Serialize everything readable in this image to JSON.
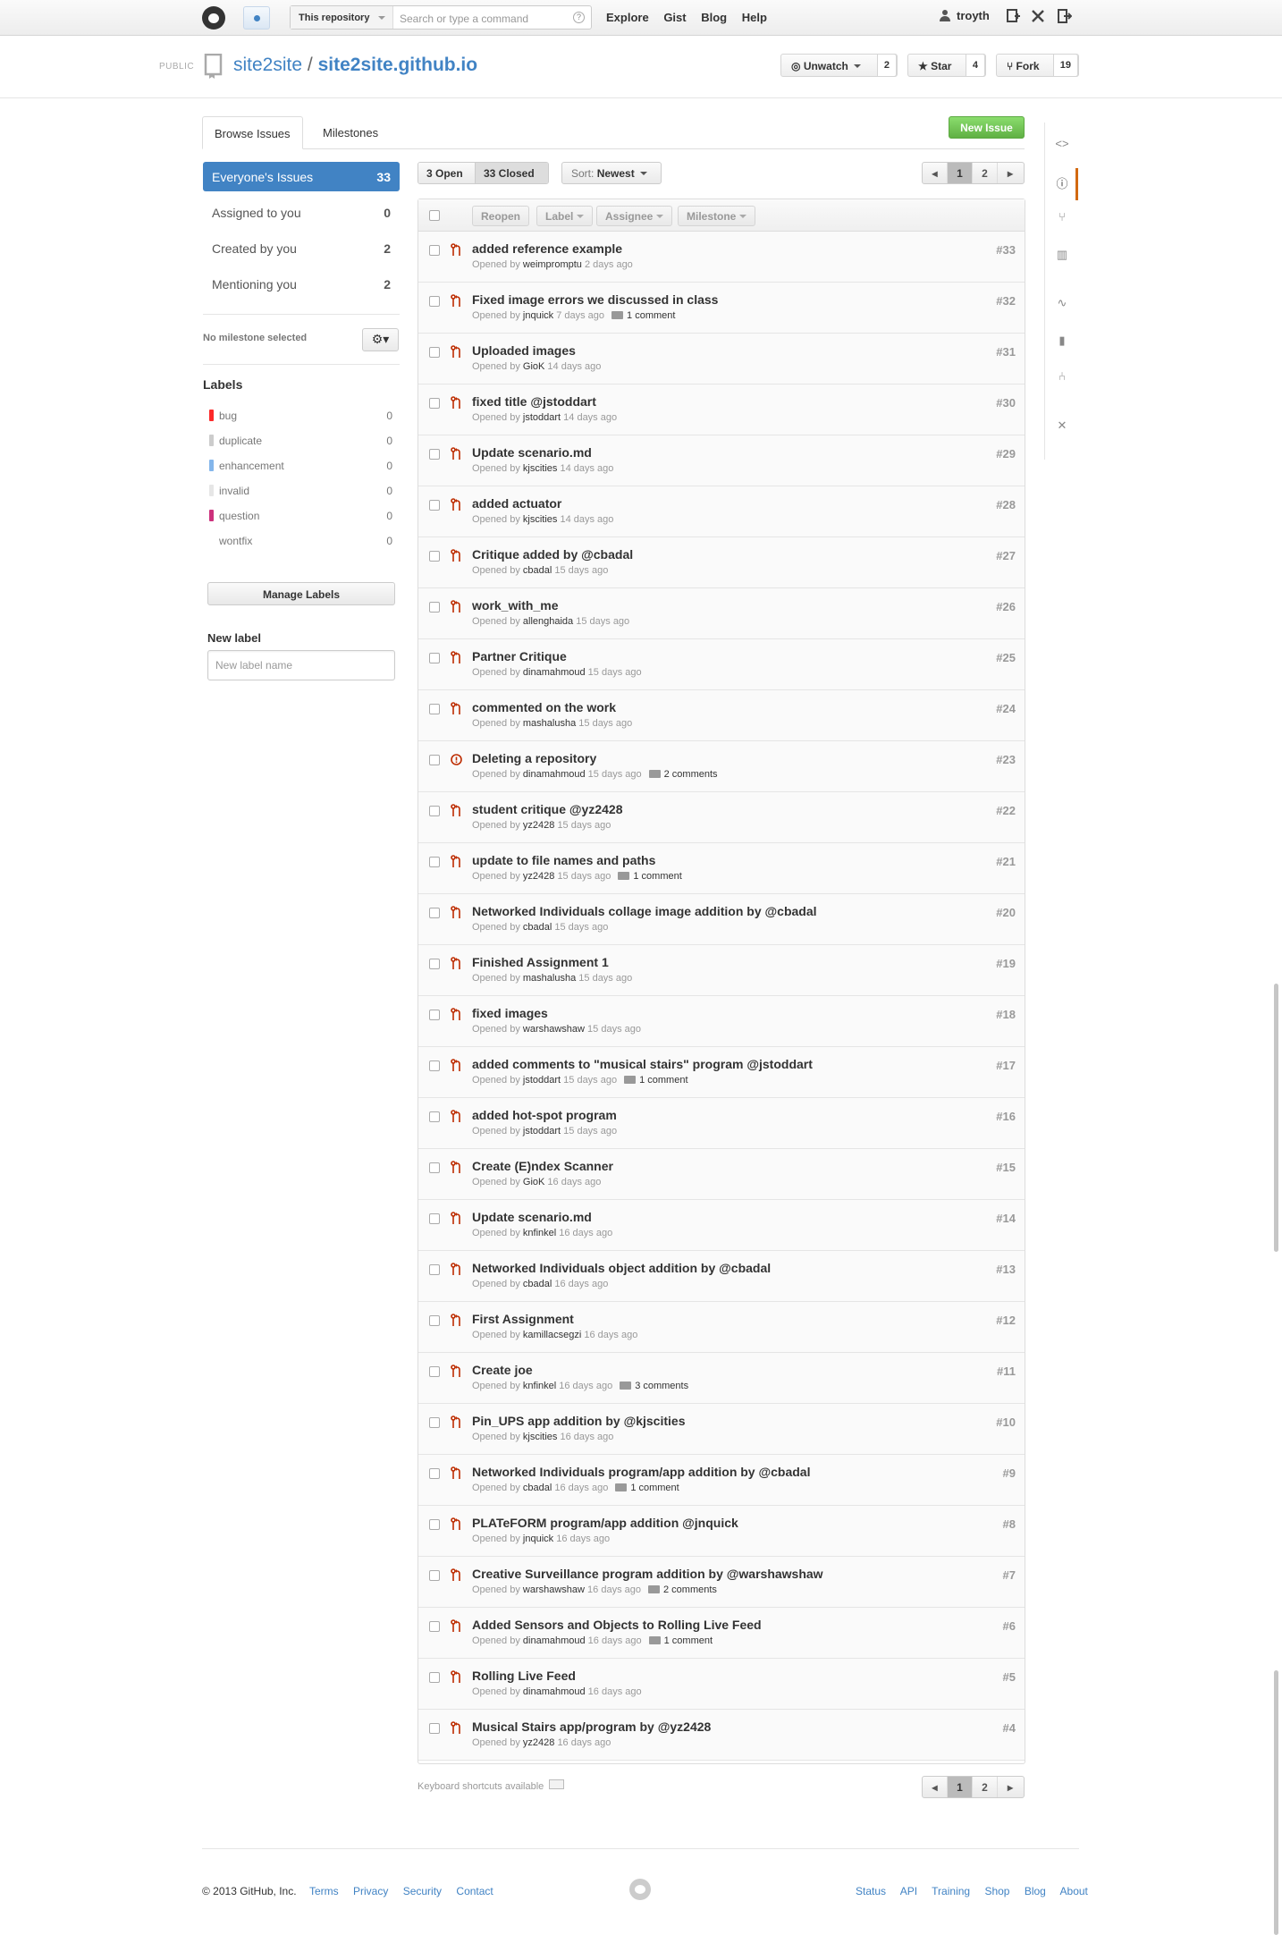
{
  "header": {
    "search_scope": "This repository",
    "search_placeholder": "Search or type a command",
    "search_help": "?",
    "nav": [
      "Explore",
      "Gist",
      "Blog",
      "Help"
    ],
    "username": "troyth"
  },
  "repo": {
    "visibility": "PUBLIC",
    "owner": "site2site",
    "separator": "/",
    "name": "site2site.github.io",
    "unwatch_label": "Unwatch",
    "watch_count": "2",
    "star_label": "Star",
    "star_count": "4",
    "fork_label": "Fork",
    "fork_count": "19"
  },
  "tabs": {
    "browse": "Browse Issues",
    "milestones": "Milestones",
    "new_issue": "New Issue"
  },
  "filters": [
    {
      "label": "Everyone's Issues",
      "count": "33"
    },
    {
      "label": "Assigned to you",
      "count": "0"
    },
    {
      "label": "Created by you",
      "count": "2"
    },
    {
      "label": "Mentioning you",
      "count": "2"
    }
  ],
  "milestone_text": "No milestone selected",
  "labels_heading": "Labels",
  "labels": [
    {
      "name": "bug",
      "count": "0",
      "color": "#fc2929"
    },
    {
      "name": "duplicate",
      "count": "0",
      "color": "#cccccc"
    },
    {
      "name": "enhancement",
      "count": "0",
      "color": "#84b6eb"
    },
    {
      "name": "invalid",
      "count": "0",
      "color": "#e6e6e6"
    },
    {
      "name": "question",
      "count": "0",
      "color": "#cc317c"
    },
    {
      "name": "wontfix",
      "count": "0",
      "color": "#ffffff"
    }
  ],
  "manage_labels": "Manage Labels",
  "new_label_heading": "New label",
  "new_label_placeholder": "New label name",
  "state": {
    "open": "3 Open",
    "closed": "33 Closed"
  },
  "sort": {
    "prefix": "Sort:",
    "value": "Newest"
  },
  "pagination": [
    "1",
    "2"
  ],
  "list_actions": [
    "Reopen",
    "Label",
    "Assignee",
    "Milestone"
  ],
  "issues": [
    {
      "title": "added reference example",
      "author": "weimpromptu",
      "age": "2 days ago",
      "comments": "",
      "number": "#33",
      "kind": "pr"
    },
    {
      "title": "Fixed image errors we discussed in class",
      "author": "jnquick",
      "age": "7 days ago",
      "comments": "1 comment",
      "number": "#32",
      "kind": "pr"
    },
    {
      "title": "Uploaded images",
      "author": "GioK",
      "age": "14 days ago",
      "comments": "",
      "number": "#31",
      "kind": "pr"
    },
    {
      "title": "fixed title @jstoddart",
      "author": "jstoddart",
      "age": "14 days ago",
      "comments": "",
      "number": "#30",
      "kind": "pr"
    },
    {
      "title": "Update scenario.md",
      "author": "kjscities",
      "age": "14 days ago",
      "comments": "",
      "number": "#29",
      "kind": "pr"
    },
    {
      "title": "added actuator",
      "author": "kjscities",
      "age": "14 days ago",
      "comments": "",
      "number": "#28",
      "kind": "pr"
    },
    {
      "title": "Critique added by @cbadal",
      "author": "cbadal",
      "age": "15 days ago",
      "comments": "",
      "number": "#27",
      "kind": "pr"
    },
    {
      "title": "work_with_me",
      "author": "allenghaida",
      "age": "15 days ago",
      "comments": "",
      "number": "#26",
      "kind": "pr"
    },
    {
      "title": "Partner Critique",
      "author": "dinamahmoud",
      "age": "15 days ago",
      "comments": "",
      "number": "#25",
      "kind": "pr"
    },
    {
      "title": "commented on the work",
      "author": "mashalusha",
      "age": "15 days ago",
      "comments": "",
      "number": "#24",
      "kind": "pr"
    },
    {
      "title": "Deleting a repository",
      "author": "dinamahmoud",
      "age": "15 days ago",
      "comments": "2 comments",
      "number": "#23",
      "kind": "issue"
    },
    {
      "title": "student critique @yz2428",
      "author": "yz2428",
      "age": "15 days ago",
      "comments": "",
      "number": "#22",
      "kind": "pr"
    },
    {
      "title": "update to file names and paths",
      "author": "yz2428",
      "age": "15 days ago",
      "comments": "1 comment",
      "number": "#21",
      "kind": "pr"
    },
    {
      "title": "Networked Individuals collage image addition by @cbadal",
      "author": "cbadal",
      "age": "15 days ago",
      "comments": "",
      "number": "#20",
      "kind": "pr"
    },
    {
      "title": "Finished Assignment 1",
      "author": "mashalusha",
      "age": "15 days ago",
      "comments": "",
      "number": "#19",
      "kind": "pr"
    },
    {
      "title": "fixed images",
      "author": "warshawshaw",
      "age": "15 days ago",
      "comments": "",
      "number": "#18",
      "kind": "pr"
    },
    {
      "title": "added comments to \"musical stairs\" program @jstoddart",
      "author": "jstoddart",
      "age": "15 days ago",
      "comments": "1 comment",
      "number": "#17",
      "kind": "pr"
    },
    {
      "title": "added hot-spot program",
      "author": "jstoddart",
      "age": "15 days ago",
      "comments": "",
      "number": "#16",
      "kind": "pr"
    },
    {
      "title": "Create (E)ndex Scanner",
      "author": "GioK",
      "age": "16 days ago",
      "comments": "",
      "number": "#15",
      "kind": "pr"
    },
    {
      "title": "Update scenario.md",
      "author": "knfinkel",
      "age": "16 days ago",
      "comments": "",
      "number": "#14",
      "kind": "pr"
    },
    {
      "title": "Networked Individuals object addition by @cbadal",
      "author": "cbadal",
      "age": "16 days ago",
      "comments": "",
      "number": "#13",
      "kind": "pr"
    },
    {
      "title": "First Assignment",
      "author": "kamillacsegzi",
      "age": "16 days ago",
      "comments": "",
      "number": "#12",
      "kind": "pr"
    },
    {
      "title": "Create joe",
      "author": "knfinkel",
      "age": "16 days ago",
      "comments": "3 comments",
      "number": "#11",
      "kind": "pr"
    },
    {
      "title": "Pin_UPS app addition by @kjscities",
      "author": "kjscities",
      "age": "16 days ago",
      "comments": "",
      "number": "#10",
      "kind": "pr"
    },
    {
      "title": "Networked Individuals program/app addition by @cbadal",
      "author": "cbadal",
      "age": "16 days ago",
      "comments": "1 comment",
      "number": "#9",
      "kind": "pr"
    },
    {
      "title": "PLATeFORM program/app addition @jnquick",
      "author": "jnquick",
      "age": "16 days ago",
      "comments": "",
      "number": "#8",
      "kind": "pr"
    },
    {
      "title": "Creative Surveillance program addition by @warshawshaw",
      "author": "warshawshaw",
      "age": "16 days ago",
      "comments": "2 comments",
      "number": "#7",
      "kind": "pr"
    },
    {
      "title": "Added Sensors and Objects to Rolling Live Feed",
      "author": "dinamahmoud",
      "age": "16 days ago",
      "comments": "1 comment",
      "number": "#6",
      "kind": "pr"
    },
    {
      "title": "Rolling Live Feed",
      "author": "dinamahmoud",
      "age": "16 days ago",
      "comments": "",
      "number": "#5",
      "kind": "pr"
    },
    {
      "title": "Musical Stairs app/program by @yz2428",
      "author": "yz2428",
      "age": "16 days ago",
      "comments": "",
      "number": "#4",
      "kind": "pr"
    }
  ],
  "opened_by": "Opened by",
  "keyboard_shortcuts": "Keyboard shortcuts available",
  "footer": {
    "copyright": "© 2013 GitHub, Inc.",
    "left_links": [
      "Terms",
      "Privacy",
      "Security",
      "Contact"
    ],
    "right_links": [
      "Status",
      "API",
      "Training",
      "Shop",
      "Blog",
      "About"
    ]
  },
  "colors": {
    "accent": "#4183c4",
    "new_issue_green": "#60b044",
    "closed_red": "#bd2c00",
    "active_tab": "#d26911"
  }
}
